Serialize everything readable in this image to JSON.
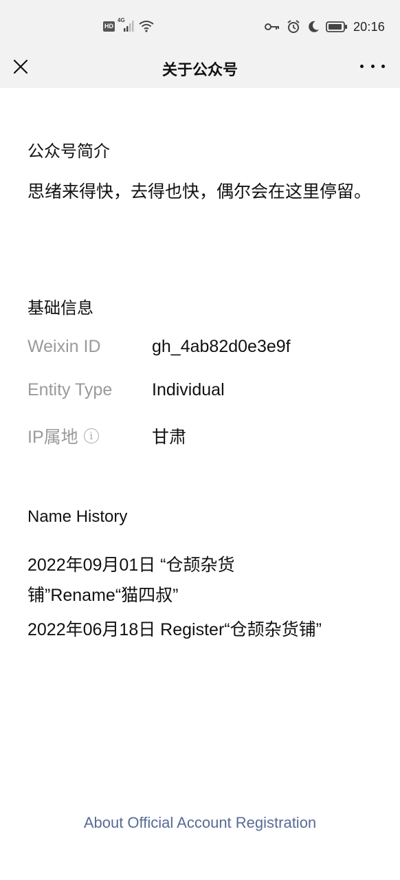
{
  "status_bar": {
    "hd_label": "HD",
    "network_label": "4G",
    "time": "20:16",
    "icons": [
      "hd-icon",
      "signal-icon",
      "wifi-icon",
      "key-icon",
      "alarm-icon",
      "moon-icon",
      "battery-icon"
    ]
  },
  "nav": {
    "title": "关于公众号",
    "close_icon": "close-icon",
    "more_icon": "more-icon"
  },
  "intro": {
    "heading": "公众号简介",
    "text": "思绪来得快，去得也快，偶尔会在这里停留。"
  },
  "basic_info": {
    "heading": "基础信息",
    "rows": [
      {
        "label": "Weixin ID",
        "value": "gh_4ab82d0e3e9f"
      },
      {
        "label": "Entity Type",
        "value": "Individual"
      },
      {
        "label": "IP属地",
        "value": "甘肃"
      }
    ]
  },
  "name_history": {
    "heading": "Name History",
    "entry1_line1": "2022年09月01日 “仓颉杂货",
    "entry1_line2": "铺”Rename“猫四叔”",
    "entry2": "2022年06月18日 Register“仓颉杂货铺”"
  },
  "footer": {
    "link": "About Official Account Registration"
  },
  "colors": {
    "background": "#ffffff",
    "bar_background": "#f2f2f2",
    "link": "#576b95",
    "label_gray": "#9a9a9a"
  }
}
